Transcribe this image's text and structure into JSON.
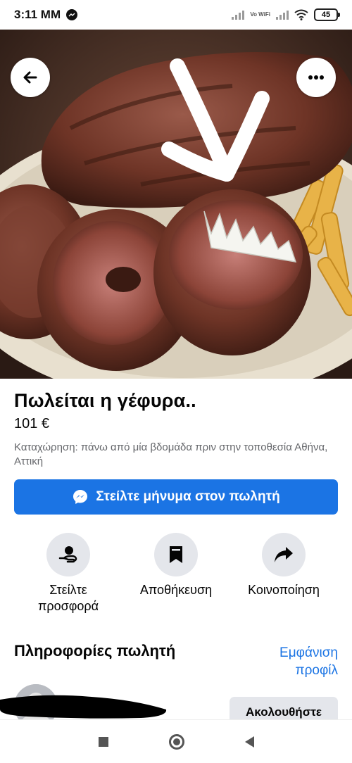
{
  "status": {
    "time": "3:11 MM",
    "vowifi": "Vo WiFi",
    "battery": "45"
  },
  "listing": {
    "title": "Πωλείται η γέφυρα..",
    "price": "101 €",
    "listed_text": "Καταχώρηση: πάνω από μία βδομάδα πριν στην τοποθεσία Αθήνα, Αττική"
  },
  "buttons": {
    "message_seller": "Στείλτε μήνυμα στον πωλητή",
    "follow": "Ακολουθήστε"
  },
  "actions": [
    {
      "label": "Στείλτε προσφορά",
      "icon": "offer-icon"
    },
    {
      "label": "Αποθήκευση",
      "icon": "bookmark-icon"
    },
    {
      "label": "Κοινοποίηση",
      "icon": "share-icon"
    }
  ],
  "seller": {
    "heading": "Πληροφορίες πωλητή",
    "profile_link": "Εμφάνιση προφίλ"
  },
  "icons": {
    "back": "back-arrow-icon",
    "more": "more-options-icon",
    "messenger": "messenger-icon"
  },
  "colors": {
    "accent": "#1b74e4",
    "chip_bg": "#e4e6eb",
    "secondary_text": "#65676b"
  }
}
